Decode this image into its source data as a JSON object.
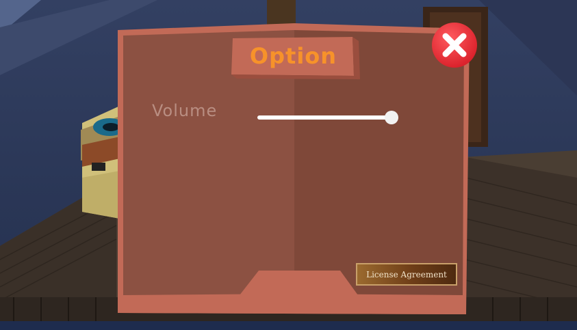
{
  "dialog": {
    "title": "Option",
    "volume_label": "Volume",
    "volume_level": 1.0,
    "license_button_label": "License Agreement",
    "close_icon": "close-icon"
  },
  "colors": {
    "panel": "#8a4f40",
    "panel_border": "#c26a57",
    "title_text": "#f7922a",
    "label_text": "#b98e82",
    "close_button": "#e8323a",
    "license_button": "#8b5a2b"
  }
}
